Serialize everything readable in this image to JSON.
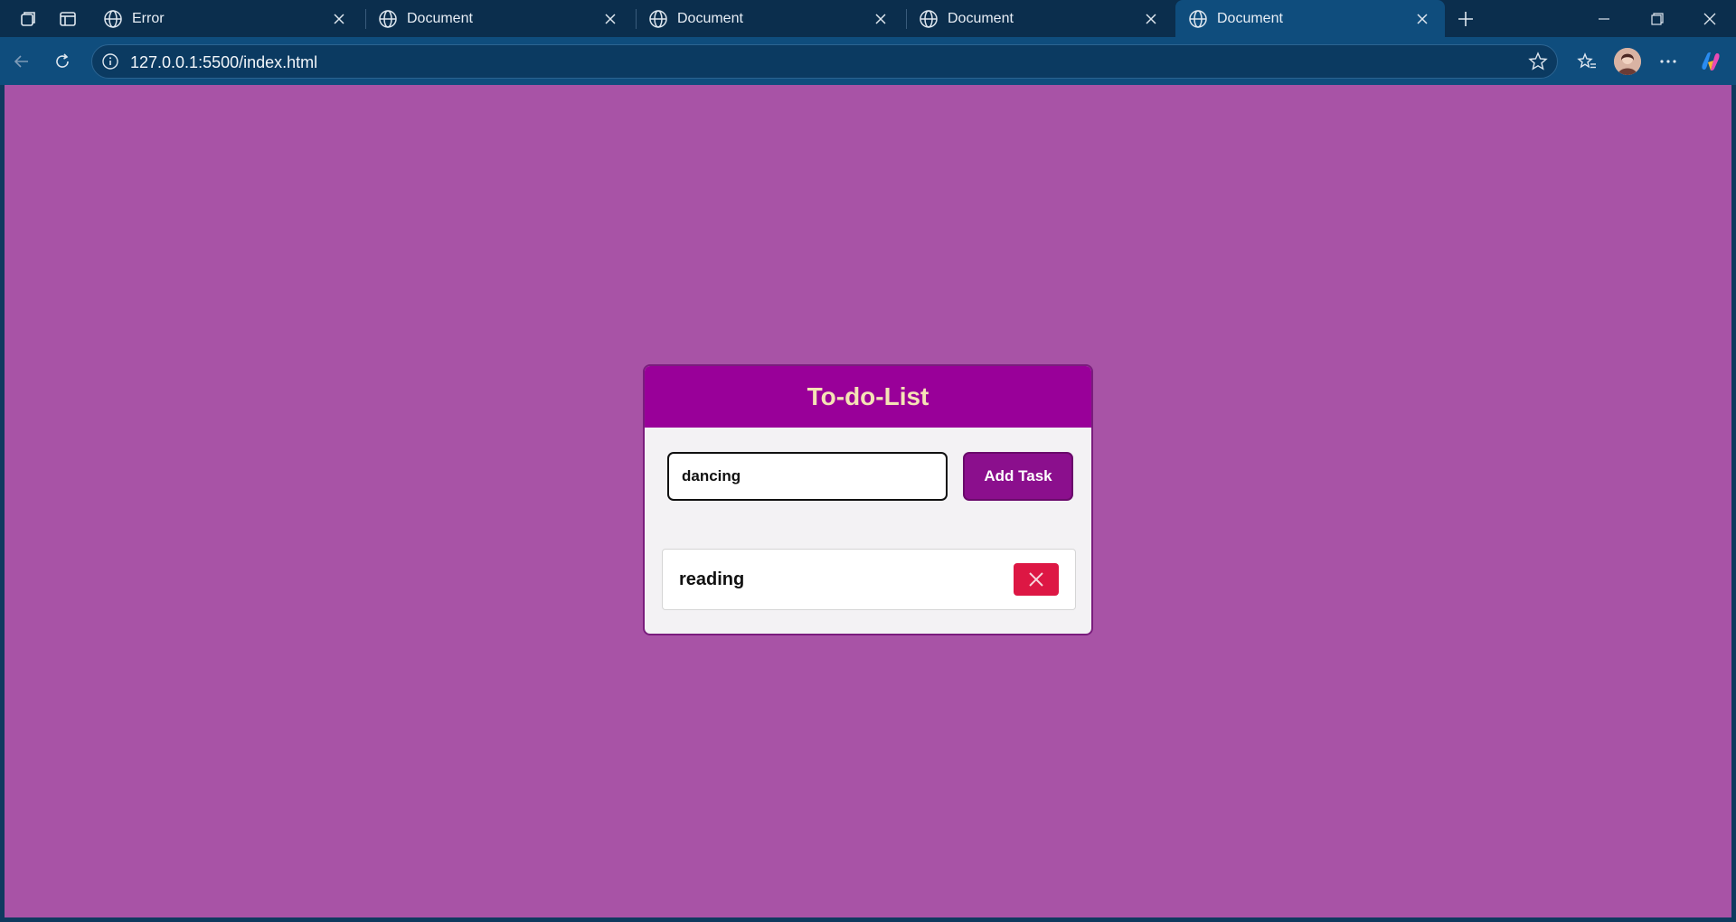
{
  "browser": {
    "tabs": [
      {
        "title": "Error"
      },
      {
        "title": "Document"
      },
      {
        "title": "Document"
      },
      {
        "title": "Document"
      },
      {
        "title": "Document"
      }
    ],
    "url": "127.0.0.1:5500/index.html",
    "colors": {
      "tabbar": "#0b2e4d",
      "toolbar": "#0f4d7d"
    }
  },
  "app": {
    "title": "To-do-List",
    "input": {
      "value": "dancing",
      "placeholder": ""
    },
    "add_button_label": "Add Task",
    "tasks": [
      {
        "text": "reading"
      }
    ],
    "colors": {
      "background": "#a853a6",
      "header": "#990099",
      "title": "#f5e3b5",
      "button": "#8b0f8d",
      "delete": "#dd1744"
    }
  }
}
